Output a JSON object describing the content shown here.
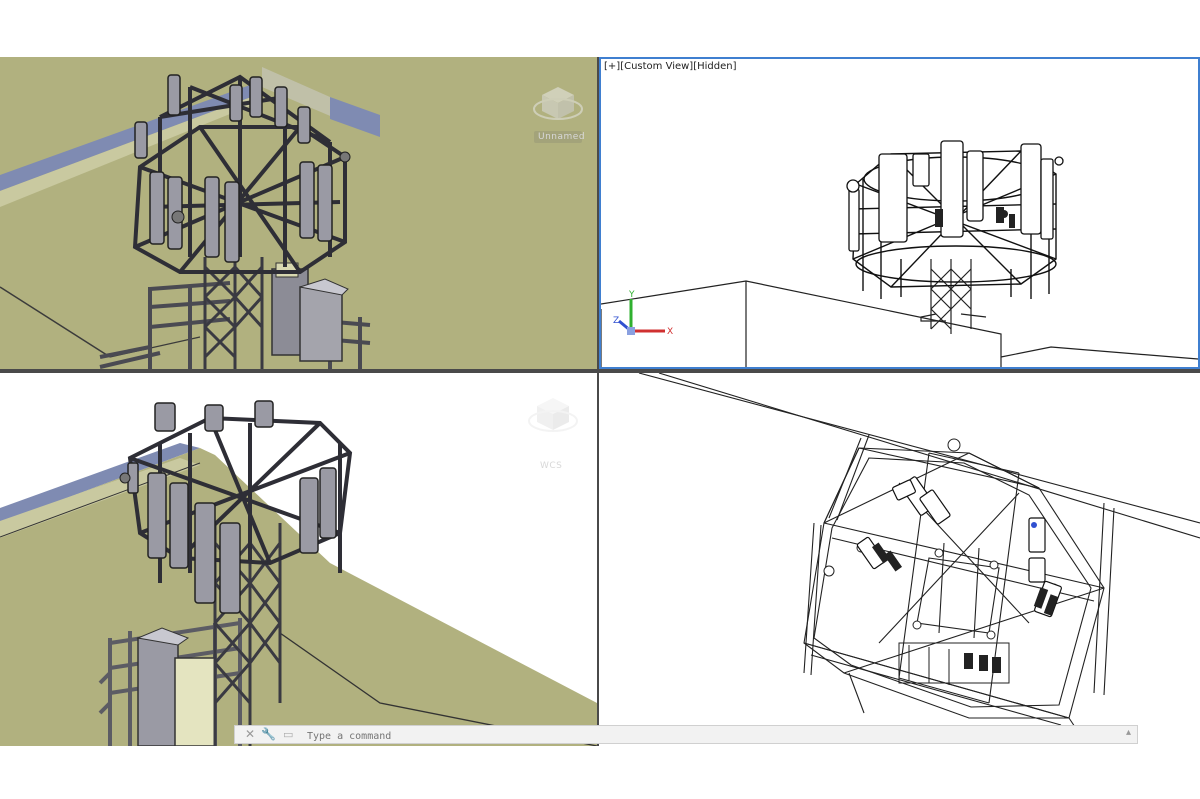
{
  "viewports": {
    "top_left": {
      "view_label": "",
      "navcube_label": "Unnamed"
    },
    "top_right": {
      "view_label_controls": "[+]",
      "view_label_view": "[Custom View]",
      "view_label_style": "[Hidden]",
      "ucs_x": "X",
      "ucs_y": "Y",
      "ucs_z": "Z",
      "active": true
    },
    "bottom_left": {
      "navcube_label": "WCS"
    },
    "bottom_right": {}
  },
  "command_line": {
    "placeholder": "Type a command",
    "close_glyph": "✕",
    "tool_glyph": "🔧",
    "prompt_glyph": "▭",
    "arrow_glyph": "▴"
  },
  "colors": {
    "model_background_tl": "#b1b17f",
    "active_viewport_border": "#3f7fd0",
    "steel": "#6e6e78",
    "wall_blue": "#7f8bb2"
  }
}
